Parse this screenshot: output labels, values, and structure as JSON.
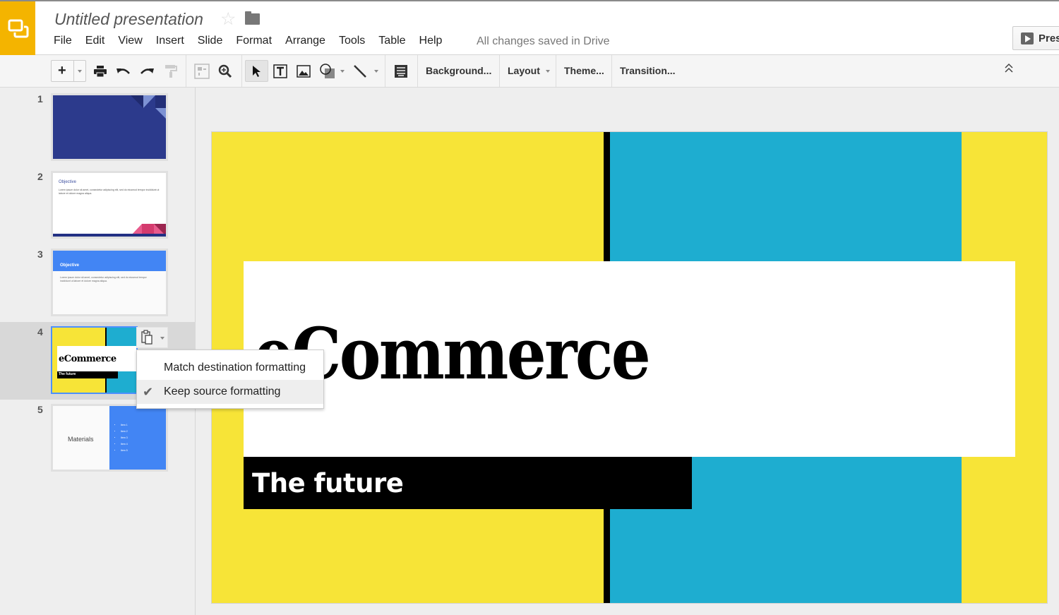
{
  "app": {
    "title": "Untitled presentation",
    "save_status": "All changes saved in Drive",
    "present_label": "Pres",
    "brand_color": "#f4b400"
  },
  "menubar": [
    "File",
    "Edit",
    "View",
    "Insert",
    "Slide",
    "Format",
    "Arrange",
    "Tools",
    "Table",
    "Help"
  ],
  "toolbar": {
    "icons": [
      "new-slide-icon",
      "print-icon",
      "undo-icon",
      "redo-icon",
      "paint-format-icon",
      "zoom-fit-icon",
      "zoom-icon",
      "select-icon",
      "text-box-icon",
      "image-icon",
      "shape-icon",
      "line-icon",
      "speaker-notes-icon",
      "collapse-icon"
    ],
    "background_label": "Background...",
    "layout_label": "Layout",
    "theme_label": "Theme...",
    "transition_label": "Transition..."
  },
  "filmstrip": {
    "slides": [
      {
        "number": "1",
        "type": "title-dark"
      },
      {
        "number": "2",
        "title": "Objective",
        "body": "Lorem ipsum dolor sit amet, consectetur adipiscing elit, sed do eiusmod tempor incididunt ut labore et dolore magna aliqua."
      },
      {
        "number": "3",
        "title": "Objective",
        "body": "Lorem ipsum dolor sit amet, consectetur adipiscing elit, sed do eiusmod tempor incididunt ut labore et dolore magna aliqua."
      },
      {
        "number": "4",
        "title": "eCommerce",
        "subtitle": "The future",
        "selected": true
      },
      {
        "number": "5",
        "title": "Materials",
        "items": [
          "Item 1",
          "Item 2",
          "Item 3",
          "Item 4",
          "Item 5"
        ]
      }
    ]
  },
  "paste_menu": {
    "items": [
      {
        "label": "Match destination formatting",
        "checked": false
      },
      {
        "label": "Keep source formatting",
        "checked": true
      }
    ]
  },
  "slide": {
    "title": "eCommerce",
    "subtitle": "The future",
    "colors": {
      "yellow": "#f7e437",
      "blue": "#1eadd0",
      "black": "#000000"
    }
  }
}
